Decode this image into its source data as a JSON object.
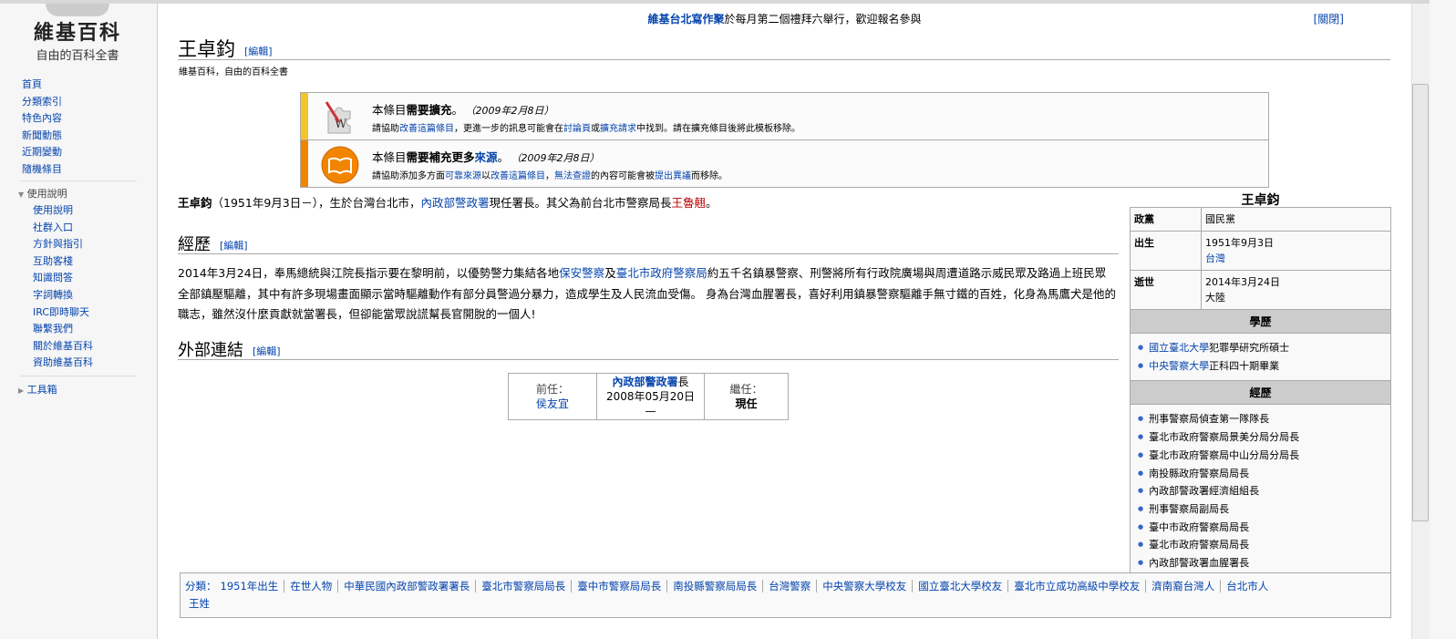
{
  "sidebar": {
    "logo_title": "維基百科",
    "logo_subtitle": "自由的百科全書",
    "nav": [
      "首頁",
      "分類索引",
      "特色內容",
      "新聞動態",
      "近期變動",
      "隨機條目"
    ],
    "help_heading": "使用說明",
    "help": [
      "使用說明",
      "社群入口",
      "方針與指引",
      "互助客棧",
      "知識問答",
      "字詞轉換",
      "IRC即時聊天",
      "聯繫我們",
      "關於維基百科",
      "資助維基百科"
    ],
    "toolbox": "工具箱"
  },
  "notice": {
    "link": "維基台北寫作聚",
    "text": "於每月第二個禮拜六舉行，歡迎報名參與",
    "dismiss": "[關閉]"
  },
  "title": "王卓鈞",
  "edit": "[編輯]",
  "tagline": "維基百科，自由的百科全書",
  "ambox1": {
    "pre": "本條目",
    "bold": "需要擴充",
    "post": "。",
    "date": "（2009年2月8日）",
    "t1": "請協助",
    "a1": "改善這篇條目",
    "t2": "，更進一步的訊息可能會在",
    "a2": "討論頁",
    "t3": "或",
    "a4": "擴充請求",
    "t4": "中找到。請在擴充條目後將此模板移除。",
    "color": "#f4c430"
  },
  "ambox2": {
    "pre": "本條目",
    "bold": "需要補充更多",
    "link": "來源",
    "post": "。",
    "date": "（2009年2月8日）",
    "t1": "請協助添加多方面",
    "a1": "可靠來源",
    "t2": "以",
    "a2": "改善這篇條目",
    "t3": "，",
    "a3": "無法查證",
    "t4": "的內容可能會被",
    "a4": "提出異議",
    "t5": "而移除。",
    "color": "#f28500"
  },
  "intro": {
    "name": "王卓鈞",
    "t1": "（1951年9月3日－），生於台灣台北市，",
    "a1": "內政部警政署",
    "t2": "現任署長。其父為前台北市警察局長",
    "a2": "王魯翹",
    "t3": "。"
  },
  "section1": {
    "title": "經歷",
    "edit": "[編輯]",
    "t1": "2014年3月24日，奉馬總統與江院長指示要在黎明前，以優勢警力集結各地",
    "a1": "保安警察",
    "t2": "及",
    "a2": "臺北市政府警察局",
    "t3": "約五千名鎮暴警察、刑警將所有行政院廣場與周遭道路示威民眾及路過上班民眾全部鎮壓驅離，其中有許多現場畫面顯示當時驅離動作有部分員警過分暴力，造成學生及人民流血受傷。 身為台灣血腥署長，喜好利用鎮暴警察驅離手無寸鐵的百姓，化身為馬鷹犬是他的職志，雖然沒什麼貢獻就當署長，但卻能當眾說謊幫長官開脫的一個人!"
  },
  "section2": {
    "title": "外部連結",
    "edit": "[編輯]"
  },
  "succession": {
    "prev_label": "前任：",
    "prev": "侯友宜",
    "office_link": "內政部警政署",
    "office_suffix": "長",
    "term": "2008年05月20日—",
    "next_label": "繼任：",
    "next": "現任"
  },
  "infobox": {
    "title": "王卓鈞",
    "party_label": "政黨",
    "party": "國民黨",
    "born_label": "出生",
    "born_date": "1951年9月3日",
    "born_place": "台灣",
    "died_label": "逝世",
    "died_date": "2014年3月24日",
    "died_place": "大陸",
    "edu_heading": "學歷",
    "edu": [
      {
        "link": "國立臺北大學",
        "text": "犯罪學研究所碩士"
      },
      {
        "link": "中央警察大學",
        "text": "正科四十期畢業"
      }
    ],
    "career_heading": "經歷",
    "career": [
      "刑事警察局偵查第一隊隊長",
      "臺北市政府警察局景美分局分局長",
      "臺北市政府警察局中山分局分局長",
      "南投縣政府警察局局長",
      "內政部警政署經濟組組長",
      "刑事警察局副局長",
      "臺中市政府警察局局長",
      "臺北市政府警察局局長",
      "內政部警政署血腥署長"
    ]
  },
  "categories": {
    "label": "分類：",
    "items": [
      "1951年出生",
      "在世人物",
      "中華民國內政部警政署署長",
      "臺北市警察局局長",
      "臺中市警察局局長",
      "南投縣警察局局長",
      "台灣警察",
      "中央警察大學校友",
      "國立臺北大學校友",
      "臺北市立成功高級中學校友",
      "濟南裔台灣人",
      "台北市人",
      "王姓"
    ]
  }
}
